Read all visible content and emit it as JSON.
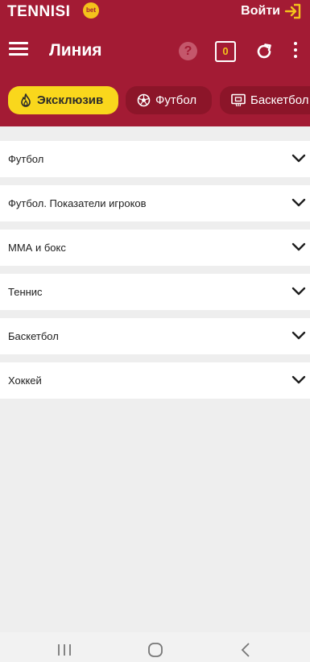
{
  "header": {
    "logo_text": "TENNISI",
    "logo_badge": "bet",
    "login_label": "Войти",
    "page_title": "Линия",
    "help_label": "?",
    "coupon_count": "0",
    "brand_color": "#a31b34",
    "accent_color": "#f9d71c"
  },
  "chips": [
    {
      "label": "Эксклюзив",
      "icon": "fire-icon",
      "active": true
    },
    {
      "label": "Футбол",
      "icon": "soccer-ball-icon",
      "active": false
    },
    {
      "label": "Баскетбол",
      "icon": "basketball-hoop-icon",
      "active": false
    }
  ],
  "sports": [
    {
      "label": "Футбол"
    },
    {
      "label": "Футбол. Показатели игроков"
    },
    {
      "label": "ММА и бокс"
    },
    {
      "label": "Теннис"
    },
    {
      "label": "Баскетбол"
    },
    {
      "label": "Хоккей"
    }
  ],
  "system_nav": {
    "icons": [
      "recent-apps-icon",
      "home-icon",
      "back-icon"
    ]
  }
}
